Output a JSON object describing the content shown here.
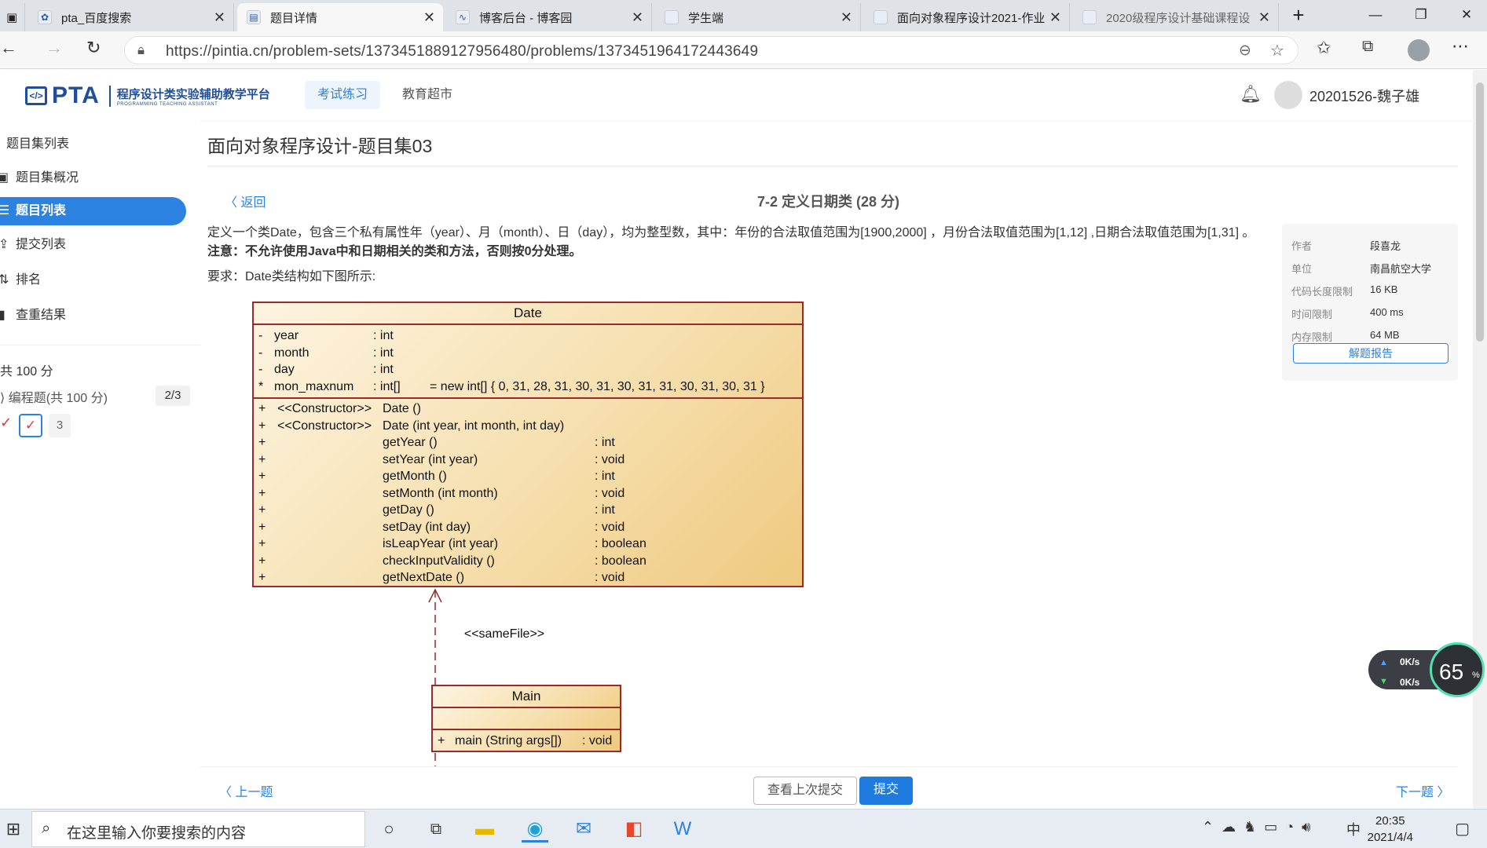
{
  "browser": {
    "tabs": [
      {
        "title": "pta_百度搜索",
        "icon": "baidu-icon"
      },
      {
        "title": "题目详情",
        "icon": "pta-icon"
      },
      {
        "title": "博客后台 - 博客园",
        "icon": "cnblogs-icon"
      },
      {
        "title": "学生端",
        "icon": "page-icon"
      },
      {
        "title": "面向对象程序设计2021-作业",
        "icon": "page-icon"
      },
      {
        "title": "2020级程序设计基础课程设",
        "icon": "page-icon"
      }
    ],
    "url": "https://pintia.cn/problem-sets/1373451889127956480/problems/1373451964172443649"
  },
  "header": {
    "logo_text": "PTA",
    "logo_cn": "程序设计类实验辅助教学平台",
    "logo_en": "PROGRAMMING TEACHING ASSISTANT",
    "nav": [
      "考试练习",
      "教育超市"
    ],
    "user": "20201526-魏子雄"
  },
  "sidebar": {
    "section_title": "题目集列表",
    "items": [
      "题目集概况",
      "题目列表",
      "提交列表",
      "排名",
      "查重结果"
    ],
    "score_total": "共 100 分",
    "category": "编程题(共 100 分)",
    "category_count": "2/3",
    "problem_num": "3"
  },
  "main": {
    "set_title": "面向对象程序设计-题目集03",
    "back": "返回",
    "problem_title": "7-2 定义日期类 (28 分)",
    "desc1": "定义一个类Date，包含三个私有属性年（year）、月（month）、日（day），均为整型数，其中：年份的合法取值范围为[1900,2000] ，月份合法取值范围为[1,12] ,日期合法取值范围为[1,31] 。",
    "desc2": "注意：不允许使用Java中和日期相关的类和方法，否则按0分处理。",
    "desc3": "要求：Date类结构如下图所示:"
  },
  "info": {
    "rows": [
      {
        "label": "作者",
        "value": "段喜龙"
      },
      {
        "label": "单位",
        "value": "南昌航空大学"
      },
      {
        "label": "代码长度限制",
        "value": "16 KB"
      },
      {
        "label": "时间限制",
        "value": "400 ms"
      },
      {
        "label": "内存限制",
        "value": "64 MB"
      }
    ],
    "report_button": "解题报告"
  },
  "uml": {
    "date_class": "Date",
    "attributes": [
      {
        "vis": "-",
        "name": "year",
        "type": ": int",
        "extra": ""
      },
      {
        "vis": "-",
        "name": "month",
        "type": ": int",
        "extra": ""
      },
      {
        "vis": "-",
        "name": "day",
        "type": ": int",
        "extra": ""
      },
      {
        "vis": "*",
        "name": "mon_maxnum",
        "type": ": int[]",
        "extra": "= new int[] { 0, 31, 28, 31, 30, 31, 30, 31, 31, 30, 31, 30, 31 }"
      }
    ],
    "methods": [
      {
        "vis": "+",
        "stereo": "<<Constructor>>",
        "name": "Date ()",
        "ret": ""
      },
      {
        "vis": "+",
        "stereo": "<<Constructor>>",
        "name": "Date (int year, int month, int day)",
        "ret": ""
      },
      {
        "vis": "+",
        "stereo": "",
        "name": "getYear ()",
        "ret": ": int"
      },
      {
        "vis": "+",
        "stereo": "",
        "name": "setYear (int year)",
        "ret": ": void"
      },
      {
        "vis": "+",
        "stereo": "",
        "name": "getMonth ()",
        "ret": ": int"
      },
      {
        "vis": "+",
        "stereo": "",
        "name": "setMonth (int month)",
        "ret": ": void"
      },
      {
        "vis": "+",
        "stereo": "",
        "name": "getDay ()",
        "ret": ": int"
      },
      {
        "vis": "+",
        "stereo": "",
        "name": "setDay (int day)",
        "ret": ": void"
      },
      {
        "vis": "+",
        "stereo": "",
        "name": "isLeapYear (int year)",
        "ret": ": boolean"
      },
      {
        "vis": "+",
        "stereo": "",
        "name": "checkInputValidity ()",
        "ret": ": boolean"
      },
      {
        "vis": "+",
        "stereo": "",
        "name": "getNextDate ()",
        "ret": ": void"
      }
    ],
    "relation": "<<sameFile>>",
    "main_class": "Main",
    "main_method": {
      "vis": "+",
      "name": "main (String args[])",
      "ret": ": void"
    }
  },
  "footer": {
    "prev": "上一题",
    "view_last": "查看上次提交",
    "submit": "提交",
    "next": "下一题"
  },
  "net_widget": {
    "up": "0K/s",
    "down": "0K/s",
    "percent": "65"
  },
  "taskbar": {
    "search_placeholder": "在这里输入你要搜索的内容",
    "ime": "中",
    "time": "20:35",
    "date": "2021/4/4"
  },
  "colors": {
    "accent": "#2b82e0",
    "uml_border": "#9b2a2a",
    "submit_bg": "#1f7be0"
  }
}
